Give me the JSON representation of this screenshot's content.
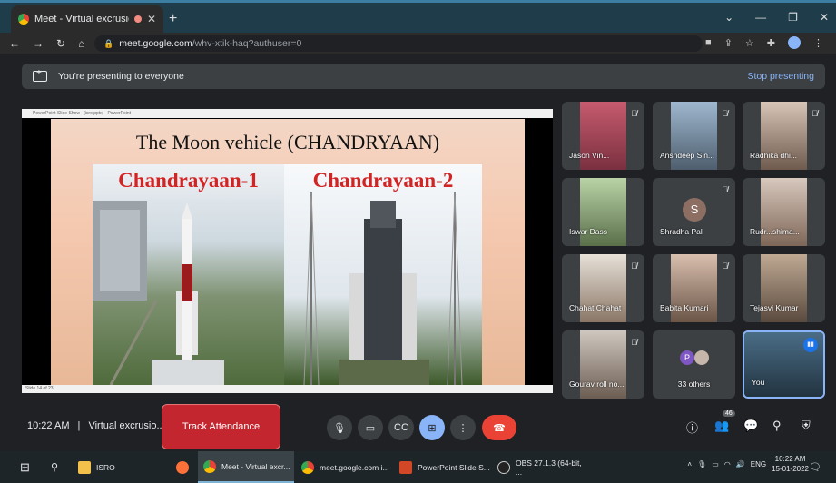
{
  "browser": {
    "tab_title": "Meet - Virtual excrusion ISRO",
    "url_host": "meet.google.com",
    "url_path": "/whv-xtik-haq?authuser=0"
  },
  "banner": {
    "text": "You're presenting to everyone",
    "stop": "Stop presenting"
  },
  "slide": {
    "app_bar": "PowerPoint Slide Show - [isro.pptx] - PowerPoint",
    "title": "The Moon vehicle (CHANDRYAAN)",
    "caption_left": "Chandrayaan-1",
    "caption_right": "Chandrayaan-2",
    "footer": "Slide 14 of 23"
  },
  "participants": [
    {
      "name": "Jason Vin...",
      "muted": true
    },
    {
      "name": "Anshdeep Sin...",
      "muted": true
    },
    {
      "name": "Radhika dhi...",
      "muted": true
    },
    {
      "name": "Iswar Dass",
      "muted": false
    },
    {
      "name": "Shradha Pal",
      "muted": true,
      "initial": "S"
    },
    {
      "name": "Rudr...shima...",
      "muted": false
    },
    {
      "name": "Chahat Chahat",
      "muted": true
    },
    {
      "name": "Babita Kumari",
      "muted": true
    },
    {
      "name": "Tejasvi Kumar",
      "muted": false
    },
    {
      "name": "Gourav roll no...",
      "muted": true
    },
    {
      "name": "33 others",
      "initial": "P"
    },
    {
      "name": "You"
    }
  ],
  "meeting": {
    "time": "10:22 AM",
    "separator": "|",
    "name": "Virtual excrusio...",
    "track_attendance": "Track Attendance",
    "participant_count": "46"
  },
  "taskbar": {
    "items": [
      {
        "label": "ISRO"
      },
      {
        "label": "Meet - Virtual excr..."
      },
      {
        "label": "meet.google.com i..."
      },
      {
        "label": "PowerPoint Slide S..."
      },
      {
        "label": "OBS 27.1.3 (64-bit, ..."
      }
    ],
    "lang": "ENG",
    "clock_time": "10:22 AM",
    "clock_date": "15-01-2022"
  },
  "colors": {
    "accent": "#8ab4f8",
    "hangup": "#ea4335",
    "attendance": "#c3262f",
    "title_red": "#d32323"
  }
}
